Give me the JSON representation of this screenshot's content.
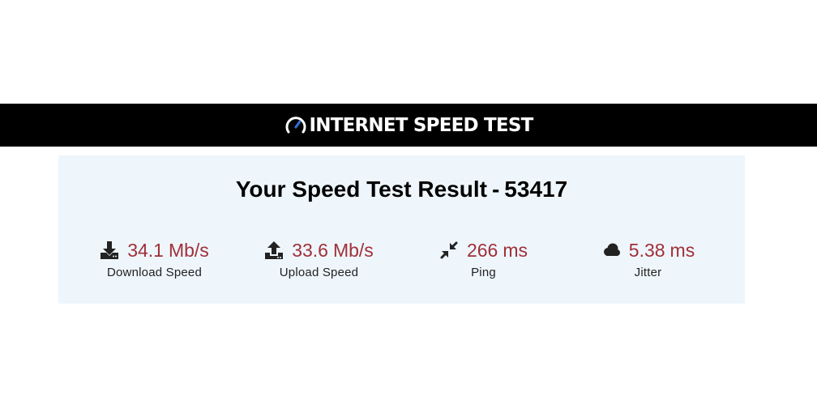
{
  "header": {
    "logo_text": "INTERNET SPEED TEST",
    "logo_icon": "speedometer-icon",
    "accent_color": "#2f6fd6"
  },
  "result": {
    "title_prefix": "Your Speed Test Result",
    "separator": "-",
    "test_id": "53417"
  },
  "metrics": [
    {
      "icon": "download-icon",
      "value": "34.1",
      "unit": "Mb/s",
      "label": "Download Speed"
    },
    {
      "icon": "upload-icon",
      "value": "33.6",
      "unit": "Mb/s",
      "label": "Upload Speed"
    },
    {
      "icon": "compress-arrows-icon",
      "value": "266",
      "unit": "ms",
      "label": "Ping"
    },
    {
      "icon": "cloud-icon",
      "value": "5.38",
      "unit": "ms",
      "label": "Jitter"
    }
  ],
  "colors": {
    "header_bg": "#000000",
    "panel_bg": "#eef6fc",
    "value_color": "#a03038"
  }
}
